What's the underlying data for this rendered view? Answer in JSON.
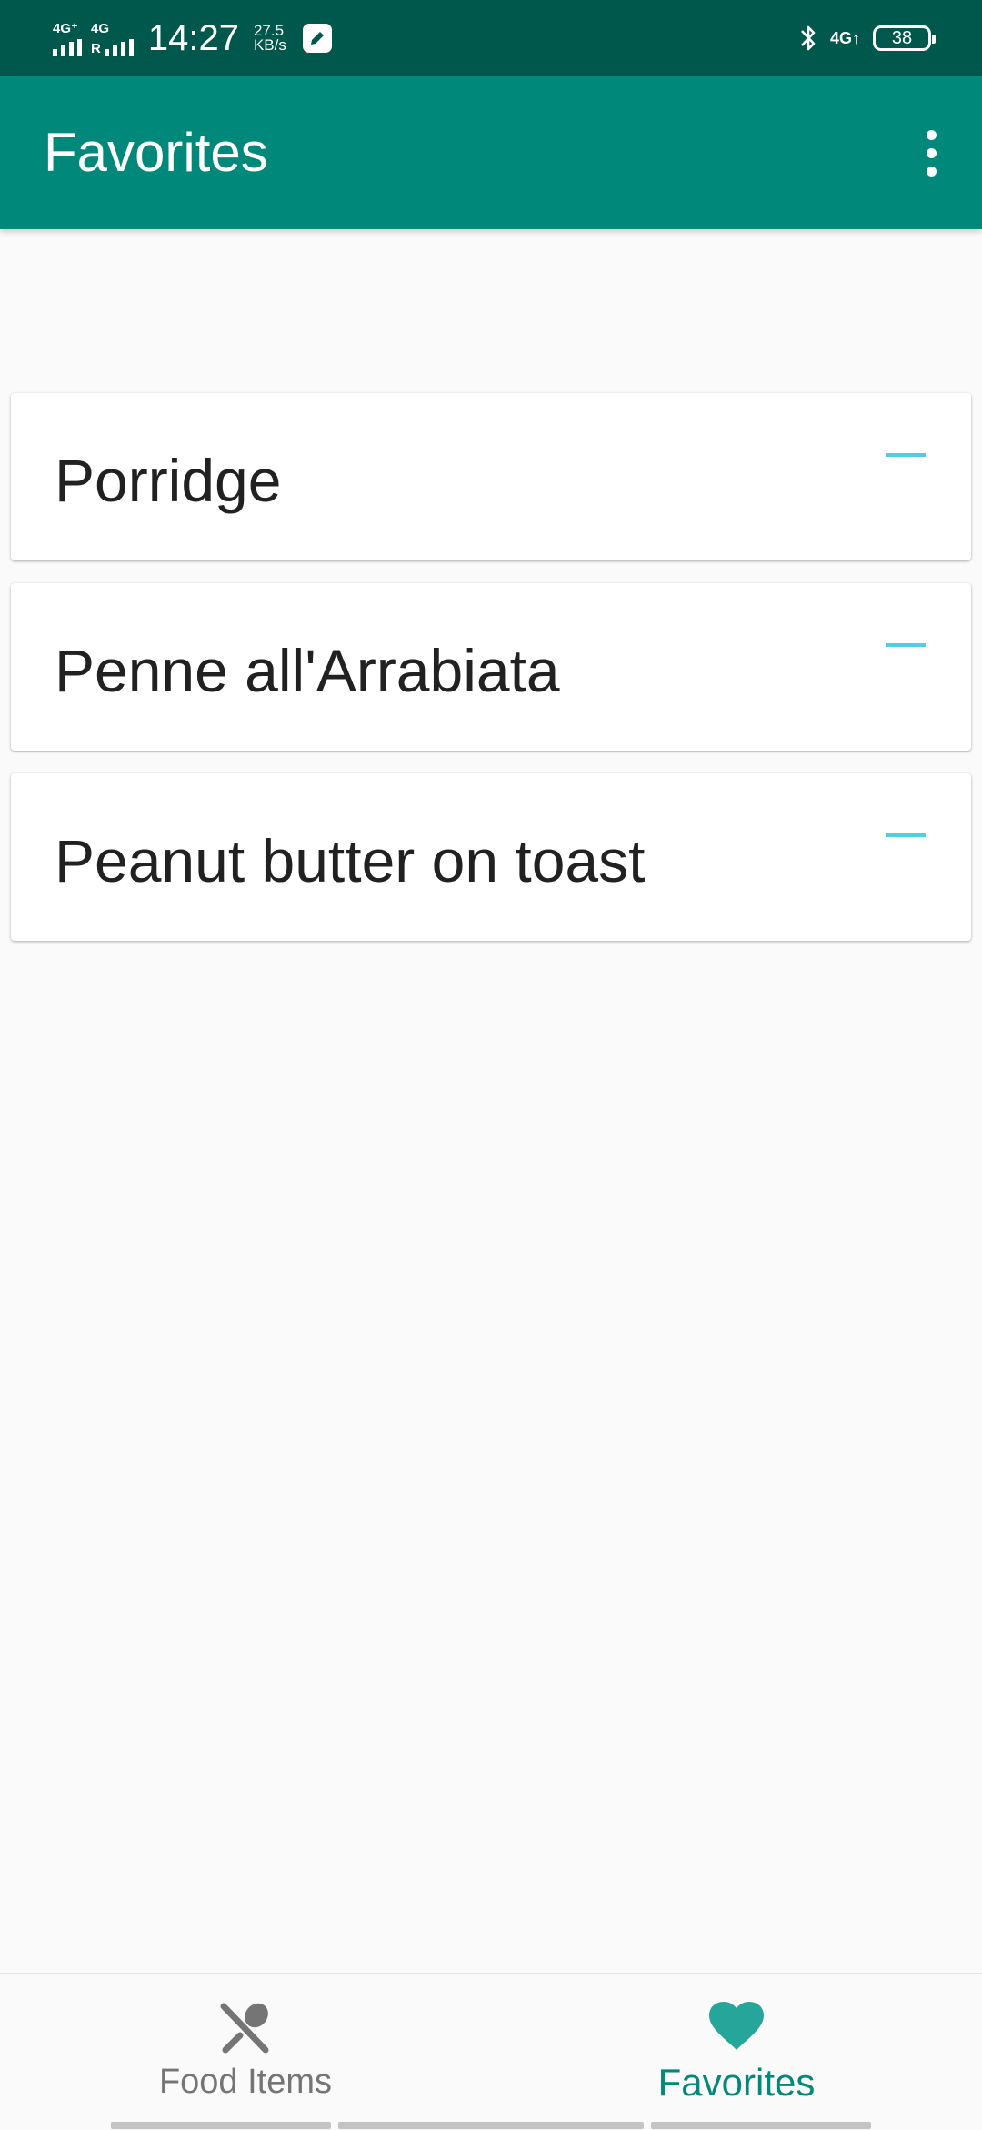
{
  "status_bar": {
    "sim1_label": "4G⁺",
    "sim2_label": "4G",
    "sim2_roaming": "R",
    "time": "14:27",
    "speed_value": "27.5",
    "speed_unit": "KB/s",
    "network_right": "4G↑",
    "battery_level": "38"
  },
  "app_bar": {
    "title": "Favorites",
    "overflow_icon": "more-vert-icon"
  },
  "favorites": [
    {
      "label": "Porridge",
      "action_icon": "remove-icon"
    },
    {
      "label": "Penne all'Arrabiata",
      "action_icon": "remove-icon"
    },
    {
      "label": "Peanut butter on toast",
      "action_icon": "remove-icon"
    }
  ],
  "bottom_nav": {
    "items": [
      {
        "label": "Food Items",
        "icon": "utensils-icon",
        "active": false
      },
      {
        "label": "Favorites",
        "icon": "heart-icon",
        "active": true
      }
    ]
  },
  "colors": {
    "status_bar": "#00574b",
    "primary": "#00897b",
    "accent": "#4dd0e1",
    "inactive": "#757575"
  }
}
